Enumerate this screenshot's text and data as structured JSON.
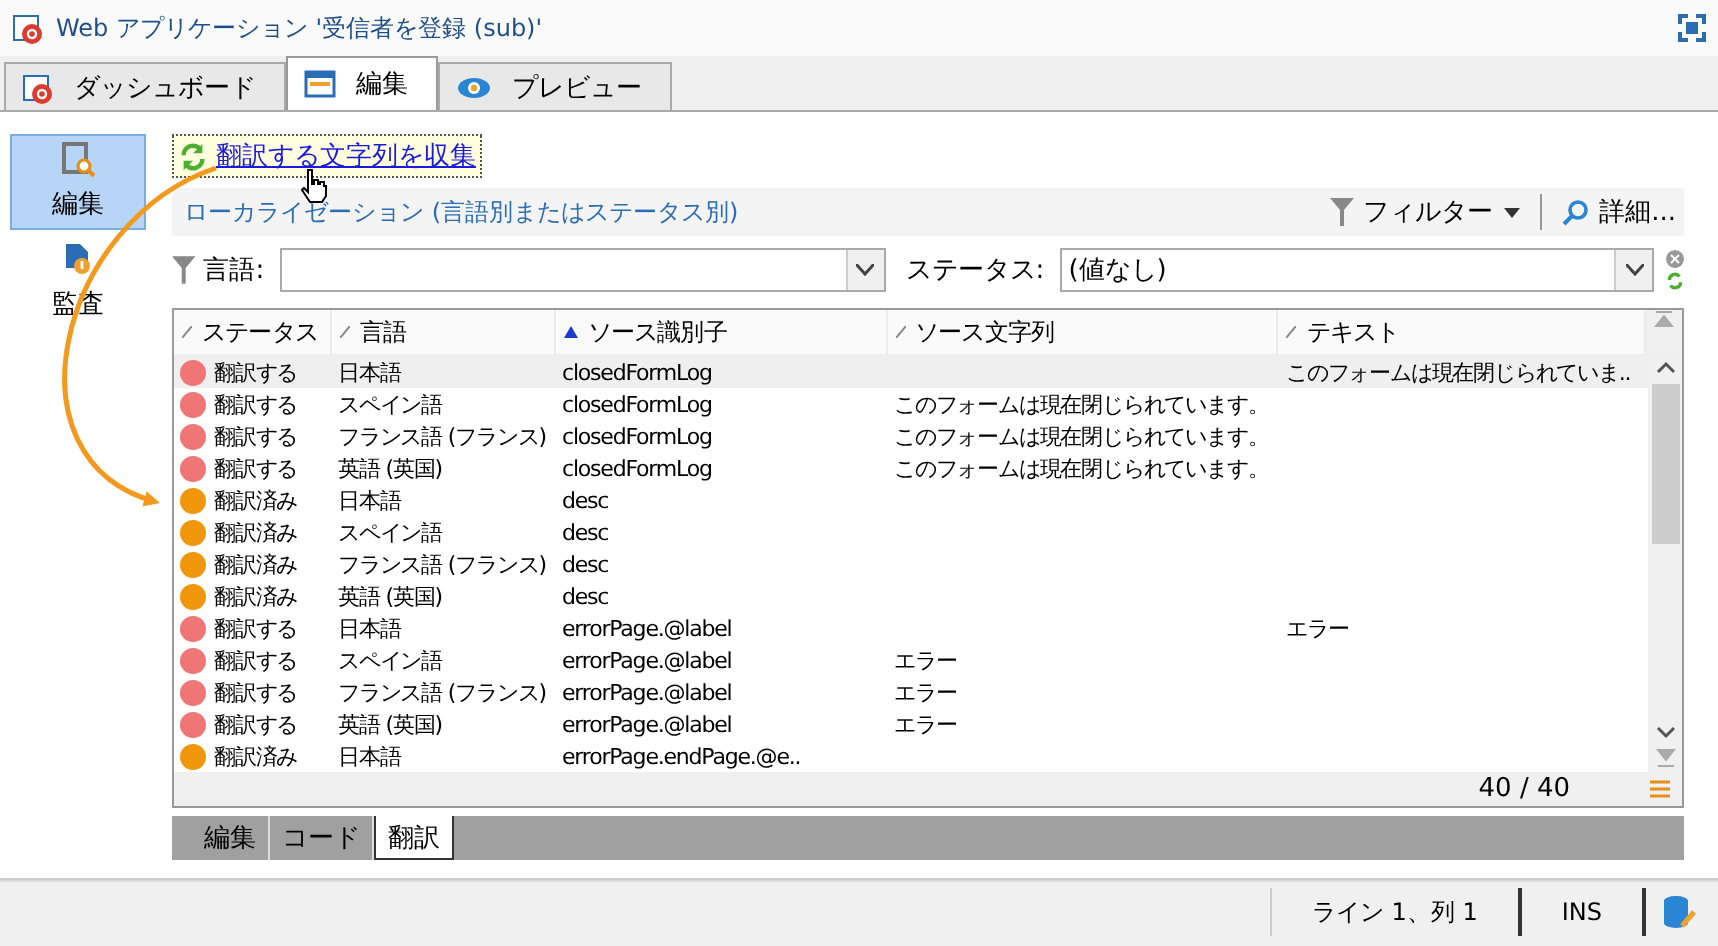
{
  "window": {
    "title": "Web アプリケーション '受信者を登録 (sub)'"
  },
  "tabs": [
    {
      "label": "ダッシュボード",
      "selected": false
    },
    {
      "label": "編集",
      "selected": true
    },
    {
      "label": "プレビュー",
      "selected": false
    }
  ],
  "sidebar": {
    "items": [
      {
        "label": "編集",
        "selected": true
      },
      {
        "label": "監査",
        "selected": false
      }
    ]
  },
  "action_link": "翻訳する文字列を収集",
  "section": {
    "title": "ローカライゼーション (言語別またはステータス別)",
    "filter_button": "フィルター",
    "details_button": "詳細..."
  },
  "filters": {
    "language": {
      "label": "言語:"
    },
    "status": {
      "label": "ステータス:",
      "value": "(値なし)"
    }
  },
  "table": {
    "columns": [
      {
        "label": "ステータス",
        "sorted": false
      },
      {
        "label": "言語",
        "sorted": false
      },
      {
        "label": "ソース識別子",
        "sorted": true
      },
      {
        "label": "ソース文字列",
        "sorted": false
      },
      {
        "label": "テキスト",
        "sorted": false
      }
    ],
    "rows": [
      {
        "status": "翻訳する",
        "color": "#f07575",
        "language": "日本語",
        "source_id": "closedFormLog",
        "text": "このフォームは現在閉じられていま..",
        "selected": true
      },
      {
        "status": "翻訳する",
        "color": "#f07575",
        "language": "スペイン語",
        "source_id": "closedFormLog",
        "source_string": "このフォームは現在閉じられています。",
        "selected": false
      },
      {
        "status": "翻訳する",
        "color": "#f07575",
        "language": "フランス語 (フランス)",
        "source_id": "closedFormLog",
        "source_string": "このフォームは現在閉じられています。",
        "selected": false
      },
      {
        "status": "翻訳する",
        "color": "#f07575",
        "language": "英語 (英国)",
        "source_id": "closedFormLog",
        "source_string": "このフォームは現在閉じられています。",
        "selected": false
      },
      {
        "status": "翻訳済み",
        "color": "#f0960a",
        "language": "日本語",
        "source_id": "desc",
        "selected": false
      },
      {
        "status": "翻訳済み",
        "color": "#f0960a",
        "language": "スペイン語",
        "source_id": "desc",
        "selected": false
      },
      {
        "status": "翻訳済み",
        "color": "#f0960a",
        "language": "フランス語 (フランス)",
        "source_id": "desc",
        "selected": false
      },
      {
        "status": "翻訳済み",
        "color": "#f0960a",
        "language": "英語 (英国)",
        "source_id": "desc",
        "selected": false
      },
      {
        "status": "翻訳する",
        "color": "#f07575",
        "language": "日本語",
        "source_id": "errorPage.@label",
        "text": "エラー",
        "selected": false
      },
      {
        "status": "翻訳する",
        "color": "#f07575",
        "language": "スペイン語",
        "source_id": "errorPage.@label",
        "source_string": "エラー",
        "selected": false
      },
      {
        "status": "翻訳する",
        "color": "#f07575",
        "language": "フランス語 (フランス)",
        "source_id": "errorPage.@label",
        "source_string": "エラー",
        "selected": false
      },
      {
        "status": "翻訳する",
        "color": "#f07575",
        "language": "英語 (英国)",
        "source_id": "errorPage.@label",
        "source_string": "エラー",
        "selected": false
      },
      {
        "status": "翻訳済み",
        "color": "#f0960a",
        "language": "日本語",
        "source_id": "errorPage.endPage.@e..",
        "selected": false
      }
    ],
    "count": "40 / 40"
  },
  "bottom_tabs": [
    {
      "label": "編集",
      "selected": false
    },
    {
      "label": "コード",
      "selected": false
    },
    {
      "label": "翻訳",
      "selected": true
    }
  ],
  "status_bar": {
    "position": "ライン 1、列 1",
    "mode": "INS"
  }
}
